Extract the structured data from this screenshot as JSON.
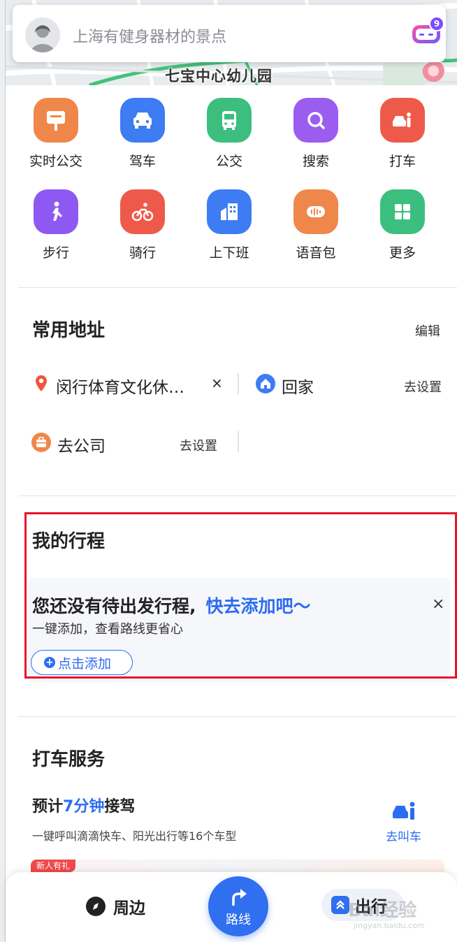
{
  "map": {
    "place_label": "七宝中心幼儿园"
  },
  "search": {
    "placeholder": "上海有健身器材的景点",
    "assistant_badge": "9"
  },
  "quick_actions": [
    {
      "label": "实时公交",
      "icon": "bus-stop-sign-icon",
      "color": "#f0874a"
    },
    {
      "label": "驾车",
      "icon": "car-icon",
      "color": "#3d7cf2"
    },
    {
      "label": "公交",
      "icon": "bus-icon",
      "color": "#3cbf7e"
    },
    {
      "label": "搜索",
      "icon": "search-icon",
      "color": "#9b5cf0"
    },
    {
      "label": "打车",
      "icon": "taxi-icon",
      "color": "#ee5a4a"
    },
    {
      "label": "步行",
      "icon": "walk-icon",
      "color": "#8e58f2"
    },
    {
      "label": "骑行",
      "icon": "bike-icon",
      "color": "#ee5a4a"
    },
    {
      "label": "上下班",
      "icon": "office-building-icon",
      "color": "#3d7cf2"
    },
    {
      "label": "语音包",
      "icon": "voice-icon",
      "color": "#f0874a"
    },
    {
      "label": "更多",
      "icon": "grid-icon",
      "color": "#3cbf7e"
    }
  ],
  "common_address": {
    "title": "常用地址",
    "edit_label": "编辑",
    "item1": "闵行体育文化休…",
    "item1_close": "×",
    "home_label": "回家",
    "home_action": "去设置",
    "company_label": "去公司",
    "company_action": "去设置"
  },
  "my_trip": {
    "title": "我的行程",
    "empty_text": "您还没有待出发行程,",
    "empty_link": "快去添加吧～",
    "sub_text": "一键添加，查看路线更省心",
    "close": "×",
    "add_button": "点击添加"
  },
  "taxi": {
    "title": "打车服务",
    "eta_prefix": "预计",
    "eta_value": "7分钟",
    "eta_suffix": "接驾",
    "sub_text": "一键呼叫滴滴快车、阳光出行等16个车型",
    "call_label": "去叫车",
    "promo_tag": "新人有礼"
  },
  "bottom_nav": {
    "around": "周边",
    "route": "路线",
    "trip": "出行"
  },
  "watermark": {
    "text": "Bai经验",
    "sub": "jingyan.baidu.com"
  },
  "colors": {
    "accent_blue": "#2c6cf2",
    "highlight_red": "#e8132d"
  }
}
